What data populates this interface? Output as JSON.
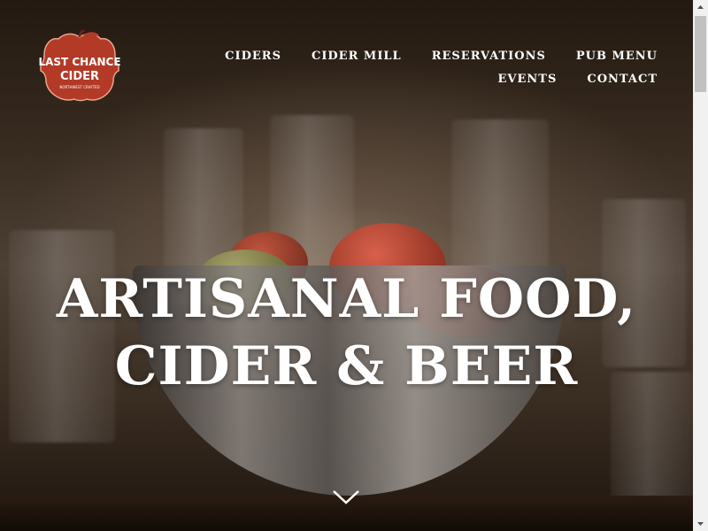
{
  "brand": {
    "name_line1": "LAST CHANCE",
    "name_line2": "CIDER",
    "tagline": "NORTHWEST CRAFTED",
    "color": "#b23a26"
  },
  "nav": {
    "row1": [
      "CIDERS",
      "CIDER MILL",
      "RESERVATIONS",
      "PUB MENU"
    ],
    "row2": [
      "EVENTS",
      "CONTACT"
    ]
  },
  "hero": {
    "headline_line1": "ARTISANAL FOOD,",
    "headline_line2": "CIDER & BEER",
    "scroll_icon": "chevron-down-icon"
  },
  "colors": {
    "text": "#ffffff",
    "scrollbar_track": "#f1f1f1",
    "scrollbar_thumb": "#c1c1c1"
  }
}
